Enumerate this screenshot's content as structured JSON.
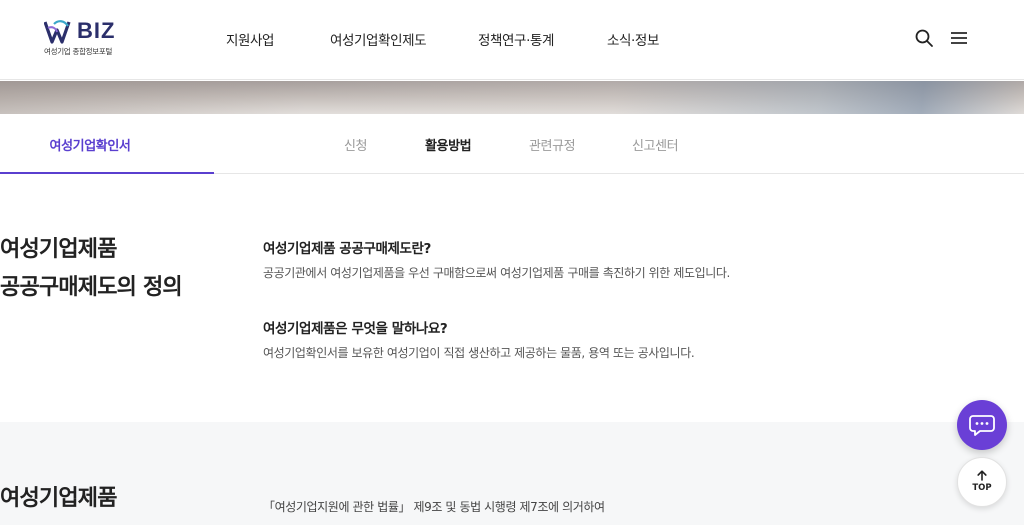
{
  "header": {
    "logo_text": "BIZ",
    "logo_sub": "여성기업 종합정보포털",
    "nav": [
      {
        "label": "지원사업"
      },
      {
        "label": "여성기업확인제도"
      },
      {
        "label": "정책연구·통계"
      },
      {
        "label": "소식·정보"
      }
    ],
    "icons": [
      "search-icon",
      "menu-icon"
    ]
  },
  "subnav": {
    "current": "여성기업확인서",
    "tabs": [
      {
        "label": "신청",
        "active": false
      },
      {
        "label": "활용방법",
        "active": true
      },
      {
        "label": "관련규정",
        "active": false
      },
      {
        "label": "신고센터",
        "active": false
      }
    ]
  },
  "section1": {
    "title_line1": "여성기업제품",
    "title_line2": "공공구매제도의 정의",
    "items": [
      {
        "question": "여성기업제품 공공구매제도란?",
        "answer": "공공기관에서 여성기업제품을 우선 구매함으로써 여성기업제품 구매를 촉진하기 위한 제도입니다."
      },
      {
        "question": "여성기업제품은 무엇을 말하나요?",
        "answer": "여성기업확인서를 보유한 여성기업이 직접 생산하고 제공하는 물품, 용역 또는 공사입니다."
      }
    ]
  },
  "section2": {
    "title": "여성기업제품",
    "text": "「여성기업지원에 관한 법률」 제9조 및 동법 시행령 제7조에 의거하여"
  },
  "floating": {
    "chat_icon": "chat-bubble-icon",
    "top_label": "TOP"
  },
  "colors": {
    "accent": "#5a3fcf",
    "chat_button": "#6a3fd6",
    "logo": "#2b2f6b"
  }
}
